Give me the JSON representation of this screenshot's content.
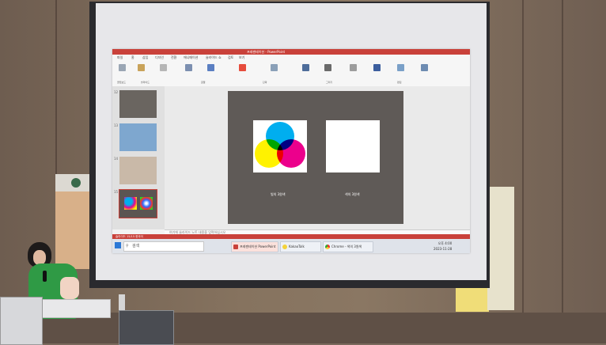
{
  "window": {
    "title": "프레젠테이션 - PowerPoint"
  },
  "ribbon": {
    "tabs": [
      "파일",
      "홈",
      "삽입",
      "디자인",
      "전환",
      "애니메이션",
      "슬라이드 쇼",
      "검토",
      "보기"
    ],
    "groups": [
      "클립보드",
      "슬라이드",
      "글꼴",
      "단락",
      "그리기",
      "편집"
    ]
  },
  "thumbnails": [
    {
      "num": "12",
      "color": "#6a6560"
    },
    {
      "num": "13",
      "color": "#7ea7cf"
    },
    {
      "num": "14",
      "color": "#c9b9a8"
    },
    {
      "num": "15",
      "color": "#5b5552"
    }
  ],
  "slide": {
    "left_caption": "빛의 3원색",
    "right_caption": "색의 3원색",
    "subtractive": {
      "colors": [
        "#00aeef",
        "#ec008c",
        "#fff200"
      ]
    },
    "additive": {
      "colors": [
        "#2b6cff",
        "#ff2d2d",
        "#22dd22"
      ]
    }
  },
  "notes": {
    "text": "여기에 슬라이드 노트 내용을 입력하십시오"
  },
  "status": {
    "text": "슬라이드 15/15  한국어"
  },
  "taskbar": {
    "search": "검색",
    "items": [
      "프레젠테이션 PowerPoint",
      "KakaoTalk",
      "Chrome - 색의 3원색"
    ],
    "time": "오후 4:00",
    "date": "2023-11-28"
  }
}
